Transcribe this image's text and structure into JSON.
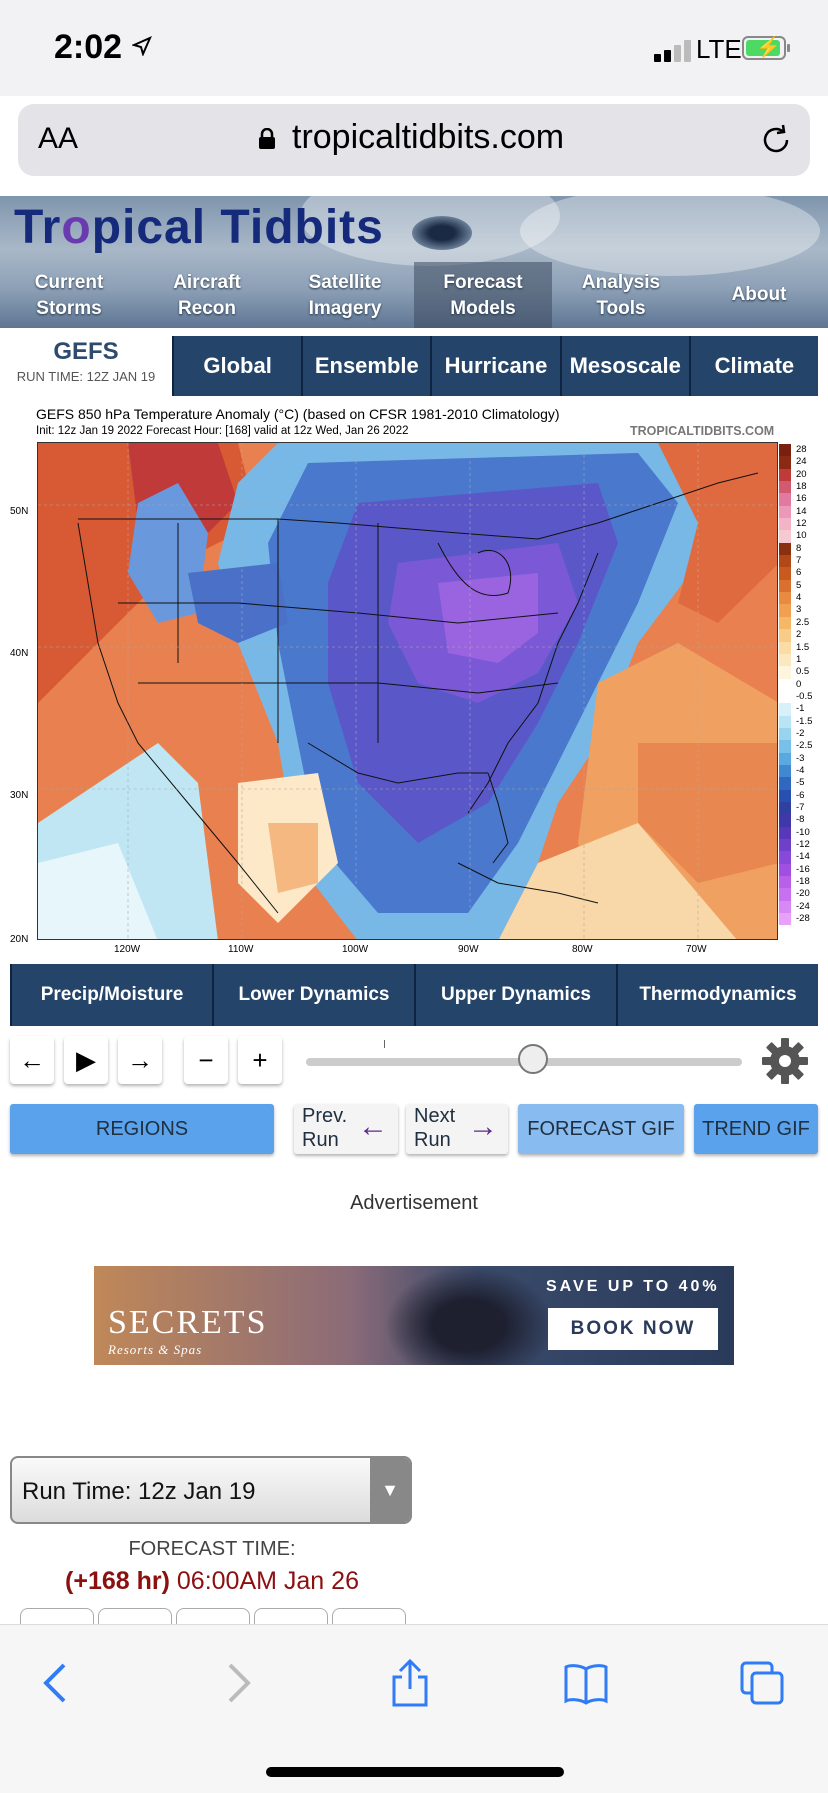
{
  "status_bar": {
    "time": "2:02",
    "network": "LTE"
  },
  "browser": {
    "text_size": "AA",
    "url": "tropicaltidbits.com"
  },
  "site": {
    "brand": "Tropical Tidbits",
    "nav": [
      {
        "line1": "Current",
        "line2": "Storms"
      },
      {
        "line1": "Aircraft",
        "line2": "Recon"
      },
      {
        "line1": "Satellite",
        "line2": "Imagery"
      },
      {
        "line1": "Forecast",
        "line2": "Models"
      },
      {
        "line1": "Analysis",
        "line2": "Tools"
      },
      {
        "line1": "About",
        "line2": ""
      }
    ]
  },
  "model": {
    "name": "GEFS",
    "run_time": "RUN TIME: 12Z JAN 19"
  },
  "model_tabs": [
    "Global",
    "Ensemble",
    "Hurricane",
    "Mesoscale",
    "Climate"
  ],
  "map": {
    "title": "GEFS 850 hPa Temperature Anomaly (°C) (based on CFSR 1981-2010 Climatology)",
    "subtitle": "Init: 12z Jan 19 2022   Forecast Hour: [168]   valid at 12z Wed, Jan 26 2022",
    "watermark": "TROPICALTIDBITS.COM",
    "lat_labels": [
      "50N",
      "40N",
      "30N",
      "20N"
    ],
    "lon_labels": [
      "120W",
      "110W",
      "100W",
      "90W",
      "80W",
      "70W"
    ],
    "scale": [
      "28",
      "24",
      "20",
      "18",
      "16",
      "14",
      "12",
      "10",
      "8",
      "7",
      "6",
      "5",
      "4",
      "3",
      "2.5",
      "2",
      "1.5",
      "1",
      "0.5",
      "0",
      "-0.5",
      "-1",
      "-1.5",
      "-2",
      "-2.5",
      "-3",
      "-4",
      "-5",
      "-6",
      "-7",
      "-8",
      "-10",
      "-12",
      "-14",
      "-16",
      "-18",
      "-20",
      "-24",
      "-28"
    ],
    "scale_colors": [
      "#7a2010",
      "#8a2a14",
      "#c03a3a",
      "#d05a70",
      "#e07aa0",
      "#ec98b8",
      "#f4b4c8",
      "#f6c8d0",
      "#8a3010",
      "#b04818",
      "#c85a20",
      "#d87030",
      "#e88a40",
      "#f0a050",
      "#f4b868",
      "#f8cc88",
      "#fadca4",
      "#fce8c0",
      "#fff4dc",
      "#ffffff",
      "#ffffff",
      "#d8f0f8",
      "#b8e4f4",
      "#98d4ee",
      "#78c0e8",
      "#5aa8e0",
      "#4088d0",
      "#3068c0",
      "#2850b0",
      "#3040a0",
      "#4038a8",
      "#5838b8",
      "#7040c8",
      "#8848d8",
      "#a050e0",
      "#b860e8",
      "#c870f0",
      "#d888f4",
      "#e8a0f8"
    ]
  },
  "categories": [
    "Precip/Moisture",
    "Lower Dynamics",
    "Upper Dynamics",
    "Thermodynamics"
  ],
  "controls": {
    "back": "←",
    "play": "▶",
    "forward": "→",
    "minus": "−",
    "plus": "+",
    "slider_position": 0.52
  },
  "buttons": {
    "regions": "REGIONS",
    "prev_run": {
      "line1": "Prev.",
      "line2": "Run"
    },
    "next_run": {
      "line1": "Next",
      "line2": "Run"
    },
    "forecast_gif": "FORECAST GIF",
    "trend_gif": "TREND GIF"
  },
  "advertisement": {
    "label": "Advertisement",
    "brand": "SECRETS",
    "brand_sub": "Resorts & Spas",
    "offer": "SAVE UP TO 40%",
    "cta": "BOOK NOW"
  },
  "run_select": {
    "value": "Run Time: 12z Jan 19"
  },
  "forecast_time": {
    "label": "FORECAST TIME:",
    "hours": "(+168 hr)",
    "time": " 06:00AM Jan 26"
  }
}
